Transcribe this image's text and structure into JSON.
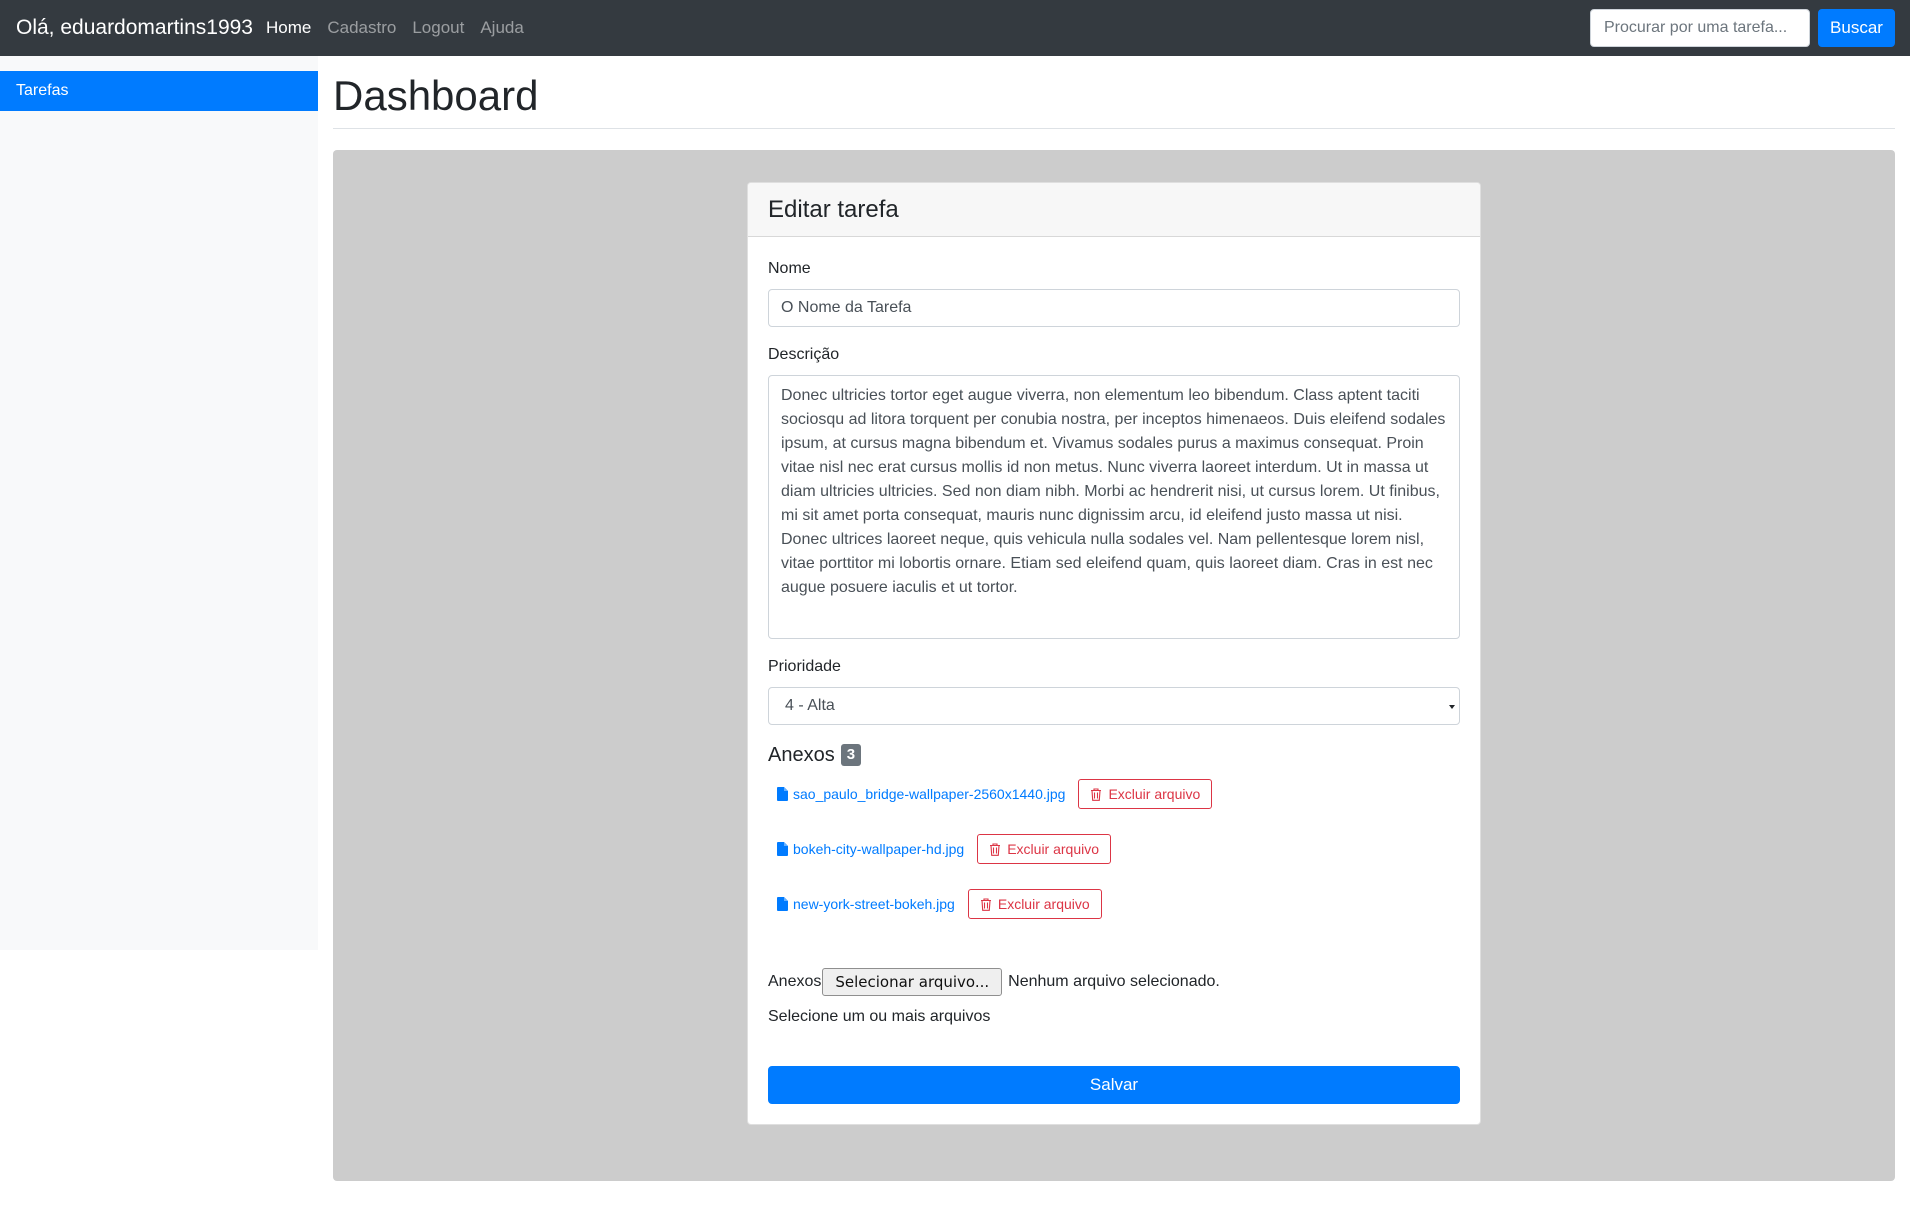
{
  "navbar": {
    "brand": "Olá, eduardomartins1993",
    "links": [
      "Home",
      "Cadastro",
      "Logout",
      "Ajuda"
    ],
    "search_placeholder": "Procurar por uma tarefa...",
    "search_button": "Buscar"
  },
  "sidebar": {
    "items": [
      "Tarefas"
    ]
  },
  "page": {
    "title": "Dashboard"
  },
  "form": {
    "title": "Editar tarefa",
    "name_label": "Nome",
    "name_value": "O Nome da Tarefa",
    "description_label": "Descrição",
    "description_value": "Donec ultricies tortor eget augue viverra, non elementum leo bibendum. Class aptent taciti sociosqu ad litora torquent per conubia nostra, per inceptos himenaeos. Duis eleifend sodales ipsum, at cursus magna bibendum et. Vivamus sodales purus a maximus consequat. Proin vitae nisl nec erat cursus mollis id non metus. Nunc viverra laoreet interdum. Ut in massa ut diam ultricies ultricies. Sed non diam nibh. Morbi ac hendrerit nisi, ut cursus lorem. Ut finibus, mi sit amet porta consequat, mauris nunc dignissim arcu, id eleifend justo massa ut nisi. Donec ultrices laoreet neque, quis vehicula nulla sodales vel. Nam pellentesque lorem nisl, vitae porttitor mi lobortis ornare. Etiam sed eleifend quam, quis laoreet diam. Cras in est nec augue posuere iaculis et ut tortor.",
    "priority_label": "Prioridade",
    "priority_value": "4 - Alta",
    "attachments_title": "Anexos",
    "attachments_count": "3",
    "attachments": [
      {
        "filename": "sao_paulo_bridge-wallpaper-2560x1440.jpg",
        "delete_label": "Excluir arquivo"
      },
      {
        "filename": "bokeh-city-wallpaper-hd.jpg",
        "delete_label": "Excluir arquivo"
      },
      {
        "filename": "new-york-street-bokeh.jpg",
        "delete_label": "Excluir arquivo"
      }
    ],
    "file_input_label": "Anexos",
    "file_input_button": "Selecionar arquivo...",
    "file_input_status": "Nenhum arquivo selecionado.",
    "file_help": "Selecione um ou mais arquivos",
    "save_button": "Salvar"
  },
  "colors": {
    "navbar_bg": "#343a40",
    "primary": "#007bff",
    "danger": "#dc3545",
    "gray_area": "#cccccc",
    "sidebar_bg": "#f8f9fa"
  }
}
